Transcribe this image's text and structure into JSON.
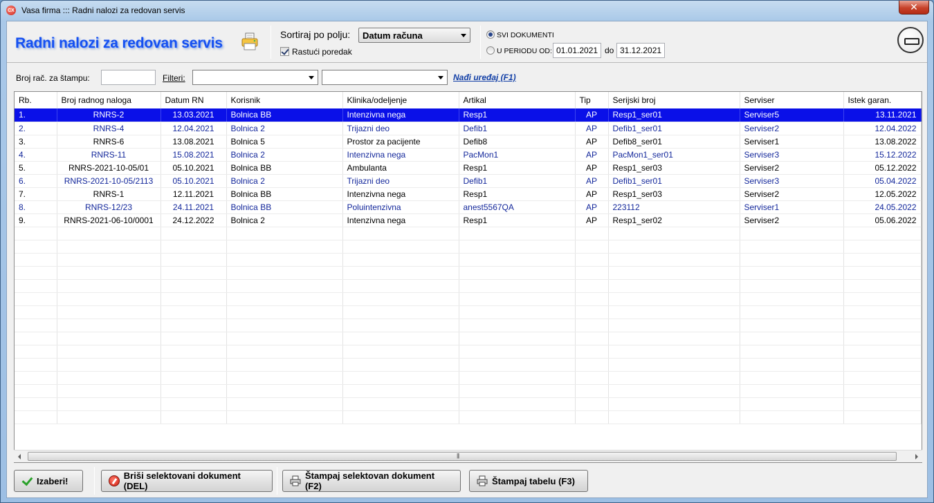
{
  "window": {
    "title": "Vasa firma ::: Radni nalozi za redovan servis",
    "icon_text": "CX",
    "close_label": "✕"
  },
  "header": {
    "title": "Radni nalozi za redovan servis",
    "sort_label": "Sortiraj po polju:",
    "sort_value": "Datum računa",
    "ascending_label": "Rastući poredak",
    "all_docs_label": "SVI DOKUMENTI",
    "period_label": "U PERIODU OD:",
    "date_from": "01.01.2021",
    "date_to_label": "do",
    "date_to": "31.12.2021"
  },
  "filters": {
    "print_label": "Broj rač. za štampu:",
    "print_value": "",
    "filters_label": "Filteri:",
    "filter1": "",
    "filter2": "",
    "find_link": "Nađi uređaj (F1)"
  },
  "table": {
    "columns": [
      "Rb.",
      "Broj radnog naloga",
      "Datum RN",
      "Korisnik",
      "Klinika/odeljenje",
      "Artikal",
      "Tip",
      "Serijski broj",
      "Serviser",
      "Istek garan."
    ],
    "rows": [
      {
        "rb": "1.",
        "broj": "RNRS-2",
        "datum": "13.03.2021",
        "korisnik": "Bolnica BB",
        "klinika": "Intenzivna nega",
        "artikal": "Resp1",
        "tip": "AP",
        "serijski": "Resp1_ser01",
        "serviser": "Serviser5",
        "istek": "13.11.2021",
        "style": "sel"
      },
      {
        "rb": "2.",
        "broj": "RNRS-4",
        "datum": "12.04.2021",
        "korisnik": "Bolnica 2",
        "klinika": "Trijazni deo",
        "artikal": "Defib1",
        "tip": "AP",
        "serijski": "Defib1_ser01",
        "serviser": "Serviser2",
        "istek": "12.04.2022",
        "style": "blue"
      },
      {
        "rb": "3.",
        "broj": "RNRS-6",
        "datum": "13.08.2021",
        "korisnik": "Bolnica 5",
        "klinika": "Prostor za pacijente",
        "artikal": "Defib8",
        "tip": "AP",
        "serijski": "Defib8_ser01",
        "serviser": "Serviser1",
        "istek": "13.08.2022",
        "style": "black"
      },
      {
        "rb": "4.",
        "broj": "RNRS-11",
        "datum": "15.08.2021",
        "korisnik": "Bolnica 2",
        "klinika": "Intenzivna nega",
        "artikal": "PacMon1",
        "tip": "AP",
        "serijski": "PacMon1_ser01",
        "serviser": "Serviser3",
        "istek": "15.12.2022",
        "style": "blue"
      },
      {
        "rb": "5.",
        "broj": "RNRS-2021-10-05/01",
        "datum": "05.10.2021",
        "korisnik": "Bolnica BB",
        "klinika": "Ambulanta",
        "artikal": "Resp1",
        "tip": "AP",
        "serijski": "Resp1_ser03",
        "serviser": "Serviser2",
        "istek": "05.12.2022",
        "style": "black"
      },
      {
        "rb": "6.",
        "broj": "RNRS-2021-10-05/2113",
        "datum": "05.10.2021",
        "korisnik": "Bolnica 2",
        "klinika": "Trijazni deo",
        "artikal": "Defib1",
        "tip": "AP",
        "serijski": "Defib1_ser01",
        "serviser": "Serviser3",
        "istek": "05.04.2022",
        "style": "blue"
      },
      {
        "rb": "7.",
        "broj": "RNRS-1",
        "datum": "12.11.2021",
        "korisnik": "Bolnica BB",
        "klinika": "Intenzivna nega",
        "artikal": "Resp1",
        "tip": "AP",
        "serijski": "Resp1_ser03",
        "serviser": "Serviser2",
        "istek": "12.05.2022",
        "style": "black"
      },
      {
        "rb": "8.",
        "broj": "RNRS-12/23",
        "datum": "24.11.2021",
        "korisnik": "Bolnica BB",
        "klinika": "Poluintenzivna",
        "artikal": "anest5567QA",
        "tip": "AP",
        "serijski": "223112",
        "serviser": "Serviser1",
        "istek": "24.05.2022",
        "style": "blue"
      },
      {
        "rb": "9.",
        "broj": "RNRS-2021-06-10/0001",
        "datum": "24.12.2022",
        "korisnik": "Bolnica 2",
        "klinika": "Intenzivna nega",
        "artikal": "Resp1",
        "tip": "AP",
        "serijski": "Resp1_ser02",
        "serviser": "Serviser2",
        "istek": "05.06.2022",
        "style": "black"
      }
    ]
  },
  "footer": {
    "select_label": "Izaberi!",
    "delete_label": "Briši selektovani dokument (DEL)",
    "print_doc_label": "Štampaj selektovan dokument (F2)",
    "print_table_label": "Štampaj tabelu (F3)"
  },
  "colors": {
    "title": "#1650f0",
    "selected_row": "#0a10e8",
    "blue_row_text": "#13279b",
    "link": "#123fa6"
  }
}
